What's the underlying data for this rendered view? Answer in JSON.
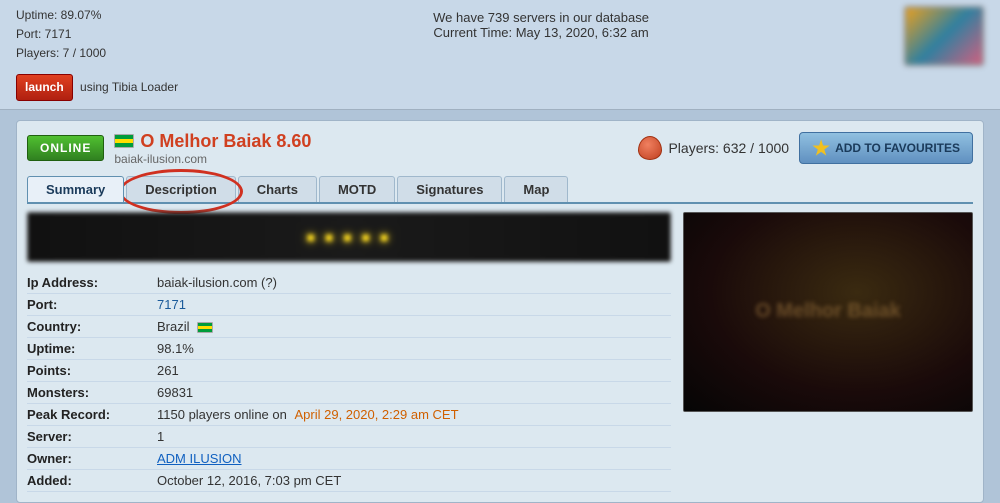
{
  "topbar": {
    "uptime_label": "Uptime: 89.07%",
    "port_label": "Port: 7171",
    "players_label": "Players: 7 / 1000",
    "server_count": "739",
    "server_count_text": "We have 739 servers in our database",
    "current_time": "Current Time: May 13, 2020, 6:32 am",
    "launch_label": "launch",
    "launch_using": "using Tibia Loader"
  },
  "server": {
    "status": "ONLINE",
    "name": "O Melhor Baiak 8.60",
    "domain": "baiak-ilusion.com",
    "players_current": "632",
    "players_max": "1000",
    "players_display": "Players: 632 / 1000",
    "add_fav_label": "ADD TO FAVOURITES"
  },
  "tabs": [
    {
      "id": "summary",
      "label": "Summary",
      "active": true
    },
    {
      "id": "description",
      "label": "Description",
      "active": false
    },
    {
      "id": "charts",
      "label": "Charts",
      "active": false
    },
    {
      "id": "motd",
      "label": "MOTD",
      "active": false
    },
    {
      "id": "signatures",
      "label": "Signatures",
      "active": false
    },
    {
      "id": "map",
      "label": "Map",
      "active": false
    }
  ],
  "info": {
    "ip_label": "Ip Address:",
    "ip_value": "baiak-ilusion.com (?)",
    "port_label": "Port:",
    "port_value": "7171",
    "country_label": "Country:",
    "country_value": "Brazil",
    "uptime_label": "Uptime:",
    "uptime_value": "98.1%",
    "points_label": "Points:",
    "points_value": "261",
    "monsters_label": "Monsters:",
    "monsters_value": "69831",
    "peak_label": "Peak Record:",
    "peak_value": "1150 players online on",
    "peak_date": "April 29, 2020, 2:29 am CET",
    "server_label": "Server:",
    "server_value": "1",
    "owner_label": "Owner:",
    "owner_value": "ADM ILUSION",
    "added_label": "Added:",
    "added_value": "October 12, 2016, 7:03 pm CET"
  }
}
